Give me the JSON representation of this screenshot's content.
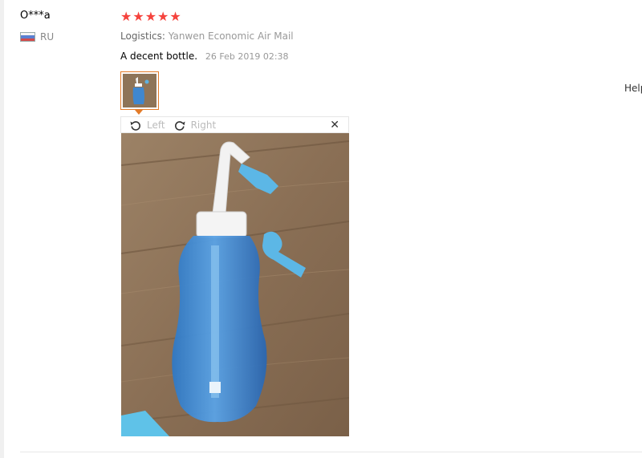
{
  "review": {
    "username": "O***a",
    "country_code": "RU",
    "rating": 5,
    "stars": [
      "★",
      "★",
      "★",
      "★",
      "★"
    ],
    "logistics_label": "Logistics:",
    "logistics_value": "Yanwen Economic Air Mail",
    "text": "A decent bottle.",
    "date": "26 Feb 2019 02:38"
  },
  "viewer": {
    "rotate_left_label": "Left",
    "rotate_right_label": "Right",
    "close_glyph": "✕"
  },
  "side": {
    "help_text": "Help"
  },
  "colors": {
    "star": "#f5433d",
    "thumb_border": "#e37b28"
  }
}
